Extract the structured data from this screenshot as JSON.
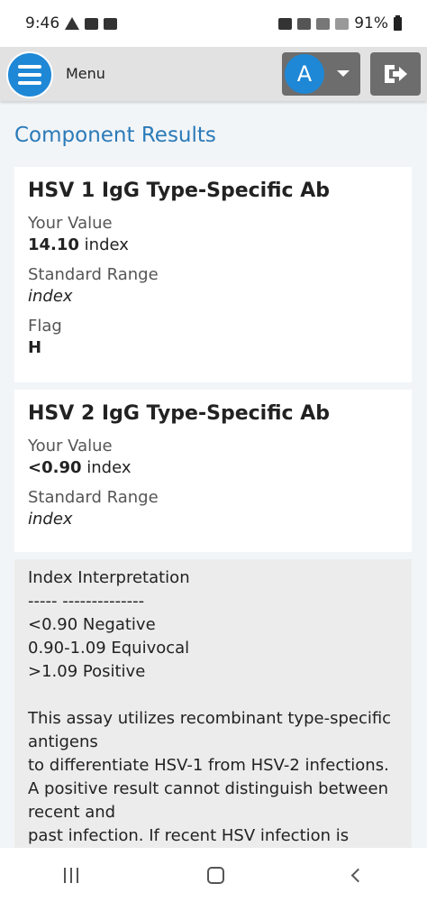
{
  "status_bar": {
    "time": "9:46",
    "battery": "91%"
  },
  "header": {
    "menu_label": "Menu",
    "avatar_initial": "A"
  },
  "page": {
    "title": "Component Results"
  },
  "components": [
    {
      "name": "HSV 1 IgG Type-Specific Ab",
      "value_label": "Your Value",
      "value": "14.10",
      "value_unit": "index",
      "range_label": "Standard Range",
      "range": "index",
      "flag_label": "Flag",
      "flag": "H"
    },
    {
      "name": "HSV 2 IgG Type-Specific Ab",
      "value_label": "Your Value",
      "value": "<0.90",
      "value_unit": "index",
      "range_label": "Standard Range",
      "range": "index"
    }
  ],
  "comment": {
    "text": "Index Interpretation\n----- --------------\n<0.90 Negative\n0.90-1.09 Equivocal\n>1.09 Positive\n\nThis assay utilizes recombinant type-specific antigens\nto differentiate HSV-1 from HSV-2 infections. A positive result cannot distinguish between recent and\npast infection. If recent HSV infection is"
  }
}
